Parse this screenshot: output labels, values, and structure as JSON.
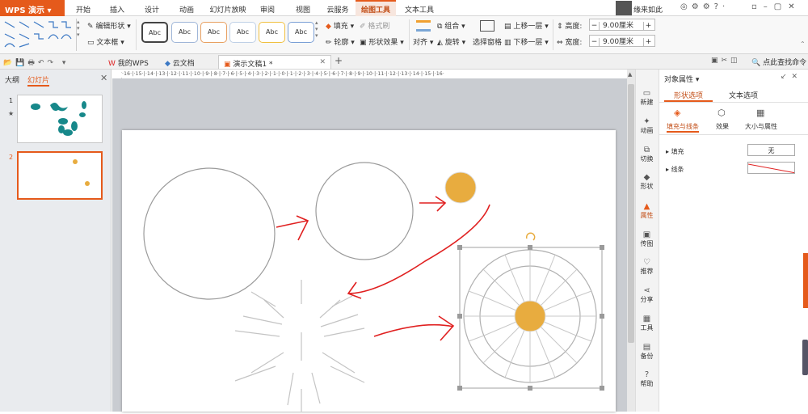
{
  "menubar": {
    "app": "WPS 演示",
    "items": [
      "开始",
      "插入",
      "设计",
      "动画",
      "幻灯片放映",
      "审阅",
      "视图",
      "云服务",
      "绘图工具",
      "文本工具"
    ],
    "user": "缘来如此"
  },
  "ribbon": {
    "edit_shape": "编辑形状",
    "text_box": "文本框",
    "style_label": "Abc",
    "fill": "填充",
    "format_brush": "格式刷",
    "outline": "轮廓",
    "shape_effect": "形状效果",
    "align": "对齐",
    "group": "组合",
    "rotate": "旋转",
    "selection_pane": "选择窗格",
    "bring_forward": "上移一层",
    "send_backward": "下移一层",
    "height_label": "高度:",
    "height_value": "9.00厘米",
    "width_label": "宽度:",
    "width_value": "9.00厘米"
  },
  "tabs": {
    "mywps": "我的WPS",
    "cloud": "云文档",
    "doc": "演示文稿1 *",
    "find_cmd": "点此查找命令"
  },
  "left": {
    "outline_tab": "大纲",
    "slides_tab": "幻灯片",
    "slide1": "1",
    "slide2": "2"
  },
  "ruler": "·16·|·15·|·14·|·13·|·12·|·11·|·10·|·9·|·8·|·7·|·6·|·5·|·4·|·3·|·2·|·1·|·0·|·1·|·2·|·3·|·4·|·5·|·6·|·7·|·8·|·9·|·10·|·11·|·12·|·13·|·14·|·15·|·16·",
  "sidetools": [
    "新建",
    "动画",
    "切换",
    "形状",
    "属性",
    "传图",
    "推荐",
    "分享",
    "工具",
    "备份",
    "帮助"
  ],
  "props": {
    "title": "对象属性",
    "tab_shape": "形状选项",
    "tab_text": "文本选项",
    "sub_fill": "填充与线条",
    "sub_effect": "效果",
    "sub_size": "大小与属性",
    "fill_label": "填充",
    "fill_value": "无",
    "line_label": "线条"
  },
  "colors": {
    "accent": "#e55a1b",
    "shape": "#e8ac3f",
    "arrow": "#e02020",
    "teal": "#17888a"
  }
}
